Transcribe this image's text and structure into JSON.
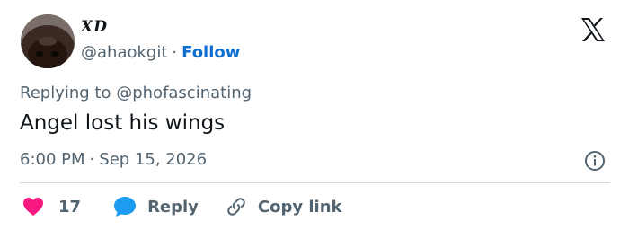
{
  "author": {
    "display_name": "XD",
    "handle": "@ahaokgit",
    "separator": "·",
    "follow_label": "Follow"
  },
  "tweet": {
    "replying_prefix": "Replying to",
    "replying_to": "@phofascinating",
    "text": "Angel lost his wings",
    "time": "6:00 PM",
    "separator": "·",
    "date": "Sep 15, 2026"
  },
  "actions": {
    "like_count": "17",
    "reply_label": "Reply",
    "copy_link_label": "Copy link"
  },
  "icons": {
    "brand": "x-logo-icon",
    "info": "info-icon",
    "like": "heart-icon",
    "reply": "speech-bubble-icon",
    "copy": "link-icon"
  },
  "colors": {
    "heart": "#f91880",
    "reply_bubble": "#1d9bf0",
    "follow": "#0f6fd1",
    "secondary_text": "#536471"
  }
}
